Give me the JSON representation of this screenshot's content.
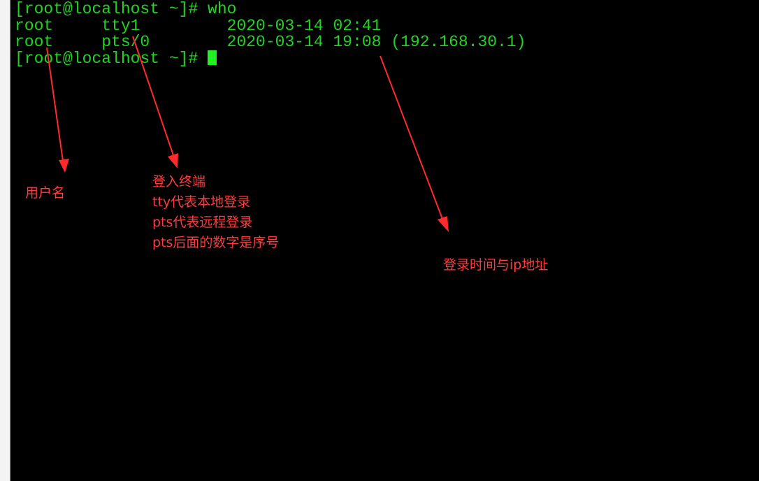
{
  "terminal": {
    "lines": {
      "prompt_who": "[root@localhost ~]# who",
      "row1": "root     tty1         2020-03-14 02:41",
      "row2": "root     pts/0        2020-03-14 19:08 (192.168.30.1)",
      "prompt_current": "[root@localhost ~]# "
    },
    "colors": {
      "text": "#22d422",
      "background": "#000000",
      "cursor": "#22f022"
    }
  },
  "annotations": {
    "username": "用户名",
    "terminal_title": "登入终端",
    "tty_note": "tty代表本地登录",
    "pts_note": "pts代表远程登录",
    "pts_number_note": "pts后面的数字是序号",
    "time_ip": "登录时间与ip地址",
    "color": "#ff3b3b"
  }
}
